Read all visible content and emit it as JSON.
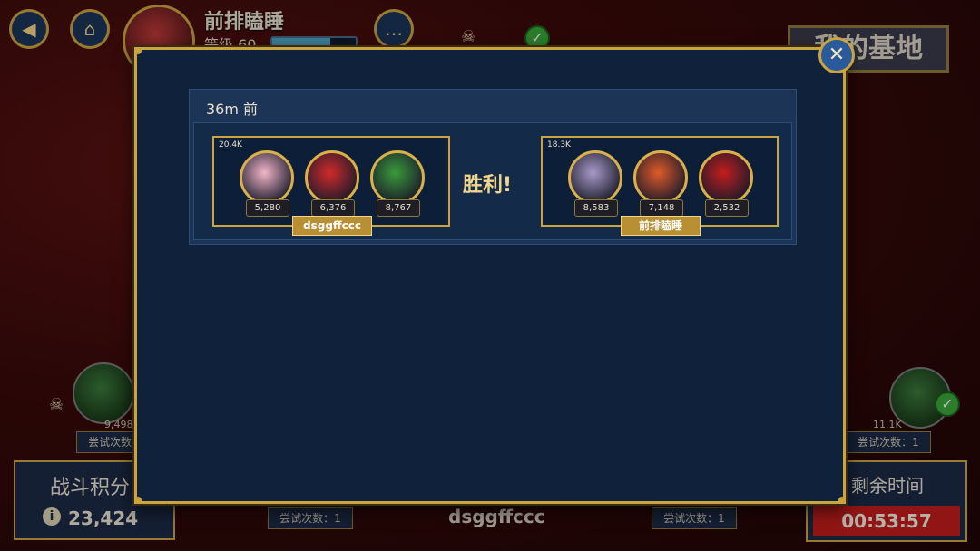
{
  "header": {
    "player_name": "前排瞌睡",
    "player_level": "等级 60",
    "xp_fraction": 0.7,
    "base_button_label": "我的基地"
  },
  "footer": {
    "score_label": "战斗积分",
    "score_value": "23,424",
    "time_label": "剩余时间",
    "time_value": "00:53:57",
    "attempt_label": "尝试次数：1",
    "opponent_name": "dsggffccc",
    "left_power": "9,498",
    "right_power": "11.1K"
  },
  "match": {
    "time_ago": "36m 前",
    "result": "胜利!",
    "team_left": {
      "power": "20.4K",
      "name": "dsggffccc",
      "heroes": [
        {
          "score": "5,280",
          "color": "#f0b6c8"
        },
        {
          "score": "6,376",
          "color": "#d02a2a"
        },
        {
          "score": "8,767",
          "color": "#3a9a3a"
        }
      ]
    },
    "team_right": {
      "power": "18.3K",
      "name": "前排瞌睡",
      "heroes": [
        {
          "score": "8,583",
          "color": "#a89ac8"
        },
        {
          "score": "7,148",
          "color": "#e05a2a"
        },
        {
          "score": "2,532",
          "color": "#c21d1d"
        }
      ]
    }
  },
  "colors": {
    "gold": "#c9a441",
    "panel": "#0f213b",
    "timer_red": "#c21d1d"
  }
}
